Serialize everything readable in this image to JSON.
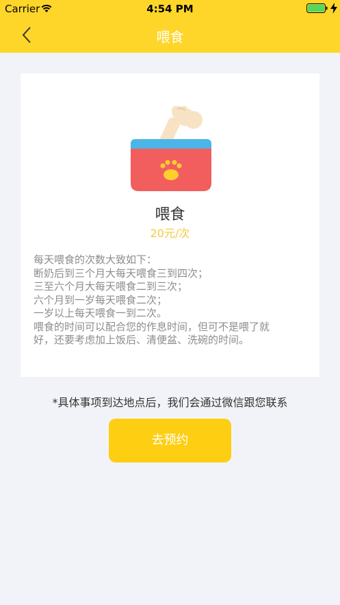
{
  "status_bar": {
    "carrier": "Carrier",
    "time": "4:54 PM",
    "wifi_icon": "wifi-icon",
    "battery_icon": "battery-icon",
    "charging_icon": "charging-icon"
  },
  "nav": {
    "title": "喂食",
    "back_icon": "chevron-left-icon"
  },
  "service": {
    "illustration": "pet-bowl-with-bone",
    "name": "喂食",
    "price": "20元/次",
    "description": [
      "每天喂食的次数大致如下：",
      "断奶后到三个月大每天喂食三到四次；",
      "三至六个月大每天喂食二到三次；",
      "六个月到一岁每天喂食二次；",
      "一岁以上每天喂食一到二次。",
      "喂食的时间可以配合您的作息时间，但可不是喂了就",
      "好，还要考虑加上饭后、清便盆、洗碗的时间。"
    ]
  },
  "notice": "*具体事项到达地点后，我们会通过微信跟您联系",
  "book_button": "去预约",
  "colors": {
    "header_bg": "#fed62a",
    "page_bg": "#f2f3f8",
    "price": "#f5c93c",
    "button_bg": "#fece13",
    "bowl_red": "#f25e5e",
    "bowl_blue": "#4bb5e8"
  }
}
